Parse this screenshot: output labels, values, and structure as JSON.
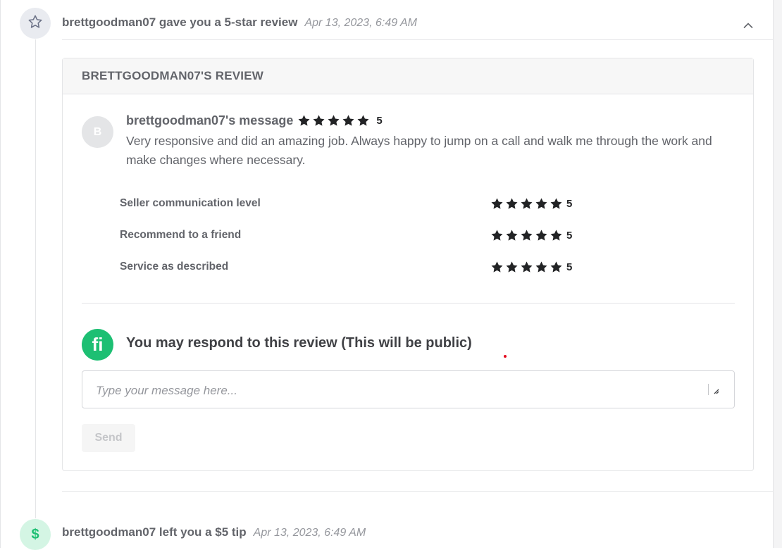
{
  "review_event": {
    "title": "brettgoodman07 gave you a 5-star review",
    "date": "Apr 13, 2023, 6:49 AM"
  },
  "review_card": {
    "header": "BRETTGOODMAN07'S REVIEW",
    "avatar_initial": "B",
    "message_author": "brettgoodman07's message",
    "overall_rating": "5",
    "message_text": "Very responsive and did an amazing job. Always happy to jump on a call and walk me through the work and make changes where necessary.",
    "sub_ratings": [
      {
        "label": "Seller communication level",
        "rating": "5"
      },
      {
        "label": "Recommend to a friend",
        "rating": "5"
      },
      {
        "label": "Service as described",
        "rating": "5"
      }
    ]
  },
  "respond": {
    "logo_text": "fi",
    "title": "You may respond to this review (This will be public)",
    "placeholder": "Type your message here...",
    "send_label": "Send"
  },
  "tip_event": {
    "icon_text": "$",
    "title": "brettgoodman07 left you a $5 tip",
    "date": "Apr 13, 2023, 6:49 AM"
  },
  "colors": {
    "brand_green": "#1dbf73",
    "star_fill": "#222325",
    "text_gray": "#62646a",
    "muted_gray": "#95979d"
  },
  "icons": {
    "event_review": "star-outline-icon",
    "collapse": "chevron-up-icon",
    "rating": "star-filled-icon",
    "tip": "dollar-icon",
    "textarea_resize": "resize-handle-icon"
  }
}
